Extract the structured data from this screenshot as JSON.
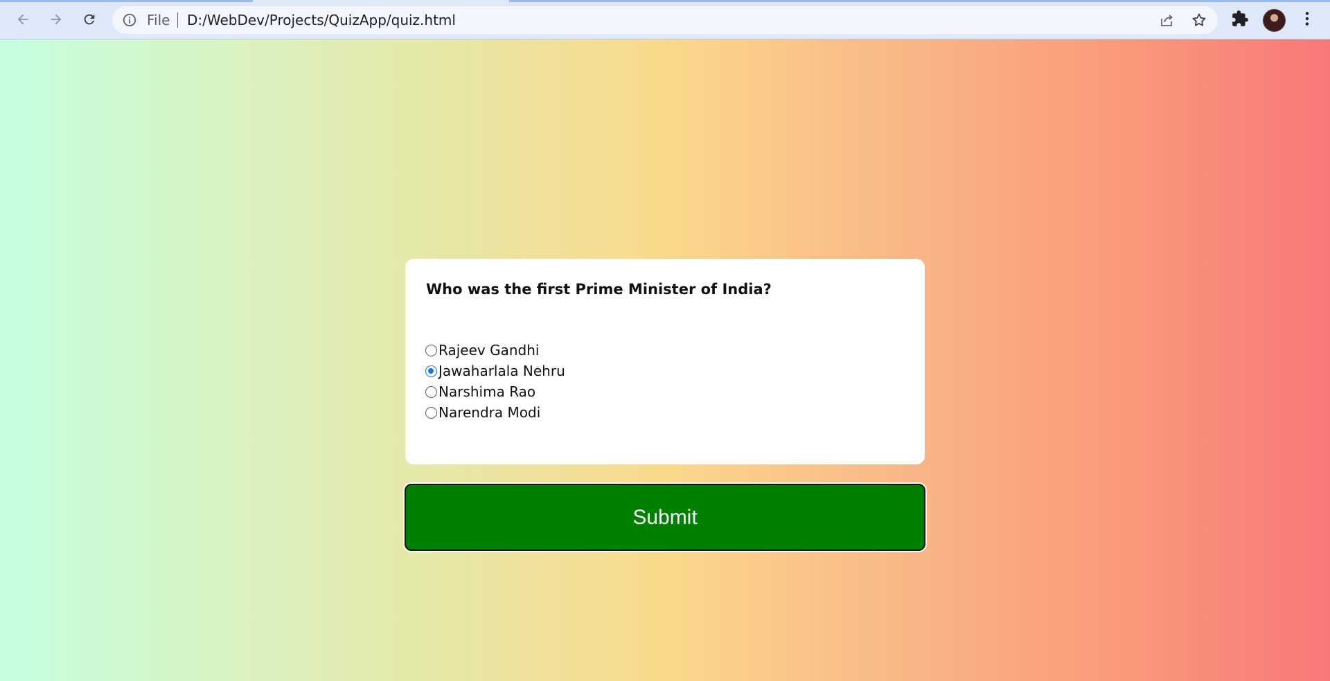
{
  "browser": {
    "scheme_label": "File",
    "url": "D:/WebDev/Projects/QuizApp/quiz.html",
    "icons": [
      "back-arrow-icon",
      "forward-arrow-icon",
      "reload-icon",
      "info-icon",
      "share-icon",
      "star-icon",
      "puzzle-icon",
      "more-vert-icon"
    ]
  },
  "quiz": {
    "question": "Who was the first Prime Minister of India?",
    "options": [
      {
        "label": "Rajeev Gandhi",
        "checked": false
      },
      {
        "label": "Jawaharlala Nehru",
        "checked": true
      },
      {
        "label": "Narshima Rao",
        "checked": false
      },
      {
        "label": "Narendra Modi",
        "checked": false
      }
    ],
    "submit_label": "Submit"
  },
  "colors": {
    "submit_bg": "#008000",
    "radio_checked": "#1a73e8"
  }
}
